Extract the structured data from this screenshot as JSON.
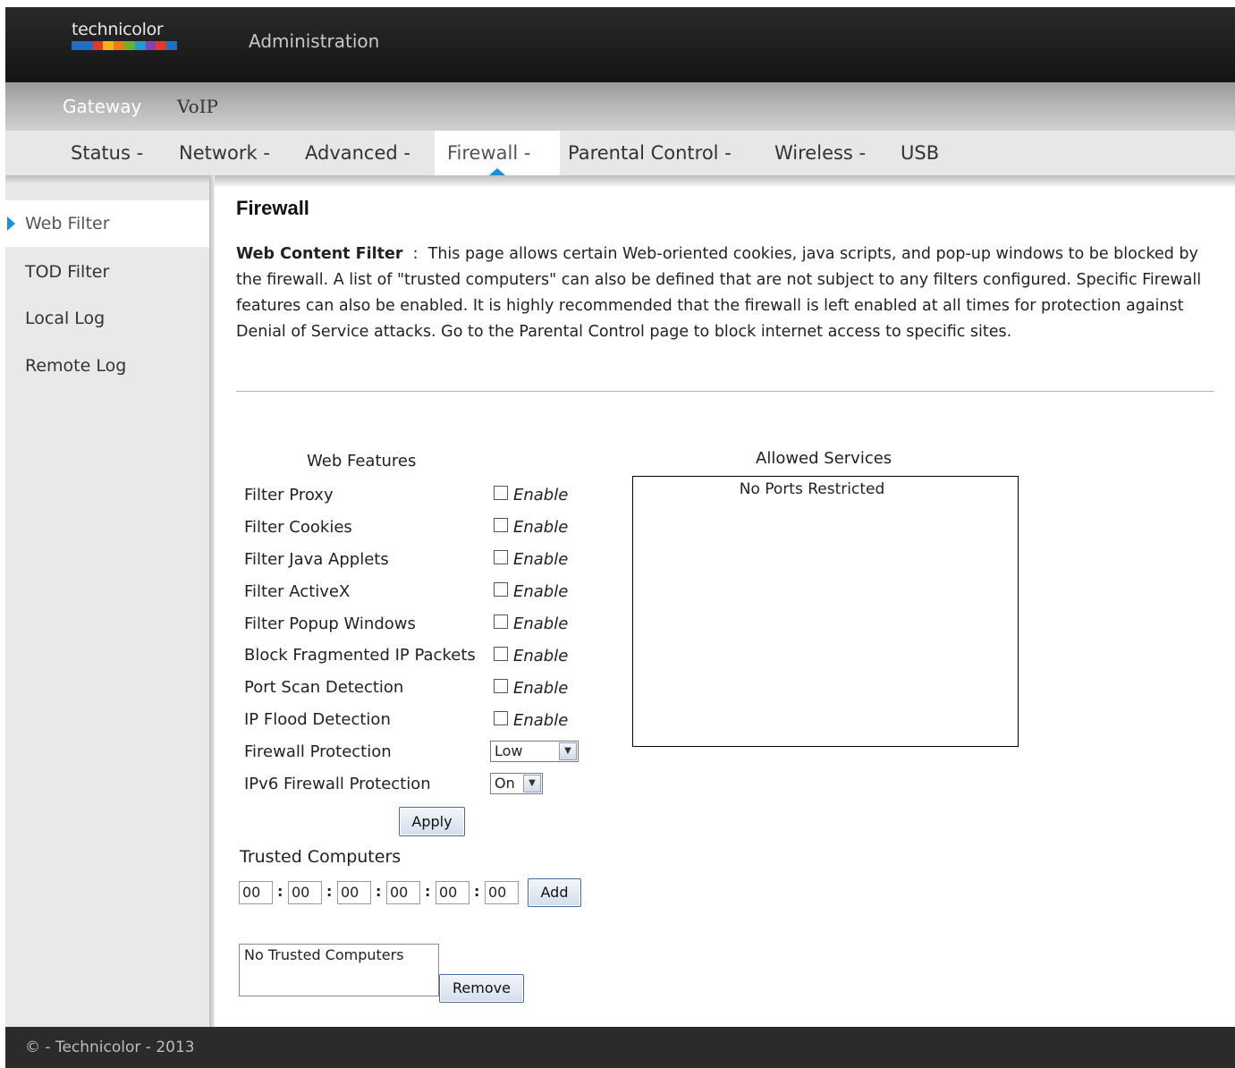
{
  "brand": {
    "logo_text": "technicolor",
    "logo_colors": [
      "#1b6fc4",
      "#1b6fc4",
      "#e23a2a",
      "#f2b318",
      "#f07a1a",
      "#6ab22e",
      "#1f9bd6",
      "#8a3fb2",
      "#e23a2a",
      "#1b6fc4"
    ]
  },
  "header": {
    "title": "Administration"
  },
  "subnav": {
    "gateway": "Gateway",
    "voip": "VoIP"
  },
  "mainnav": {
    "items": [
      {
        "label": "Status -"
      },
      {
        "label": "Network -"
      },
      {
        "label": "Advanced -"
      },
      {
        "label": "Firewall -",
        "active": true
      },
      {
        "label": "Parental Control -"
      },
      {
        "label": "Wireless -"
      },
      {
        "label": "USB"
      }
    ]
  },
  "sidebar": {
    "items": [
      {
        "label": "Web Filter",
        "active": true
      },
      {
        "label": "TOD Filter"
      },
      {
        "label": "Local Log"
      },
      {
        "label": "Remote Log"
      }
    ]
  },
  "page": {
    "title": "Firewall",
    "intro_bold": "Web Content Filter",
    "intro_sep": "  :  ",
    "intro_text": "This page allows certain Web-oriented cookies, java scripts, and pop-up windows to be blocked by the firewall. A list of \"trusted computers\" can also be defined that are not subject to any filters configured. Specific Firewall features can also be enabled. It is highly recommended that the firewall is left enabled at all times for protection against Denial of Service attacks. Go to the Parental Control page to block internet access to specific sites."
  },
  "features": {
    "heading": "Web Features",
    "enable_label": "Enable",
    "rows": [
      {
        "label": "Filter Proxy",
        "checked": false
      },
      {
        "label": "Filter Cookies",
        "checked": false
      },
      {
        "label": "Filter Java Applets",
        "checked": false
      },
      {
        "label": "Filter ActiveX",
        "checked": false
      },
      {
        "label": "Filter Popup Windows",
        "checked": false
      },
      {
        "label": "Block Fragmented IP Packets",
        "checked": false
      },
      {
        "label": "Port Scan Detection",
        "checked": false
      },
      {
        "label": "IP Flood Detection",
        "checked": false
      }
    ],
    "firewall_protection_label": "Firewall Protection",
    "firewall_protection_value": "Low",
    "ipv6_label": "IPv6 Firewall Protection",
    "ipv6_value": "On",
    "apply_label": "Apply"
  },
  "allowed": {
    "heading": "Allowed Services",
    "text": "No Ports Restricted"
  },
  "trusted": {
    "label": "Trusted Computers",
    "mac": [
      "00",
      "00",
      "00",
      "00",
      "00",
      "00"
    ],
    "separator": ":",
    "add_label": "Add",
    "list_text": "No Trusted Computers",
    "remove_label": "Remove"
  },
  "footer": {
    "text": "© - Technicolor - 2013"
  }
}
